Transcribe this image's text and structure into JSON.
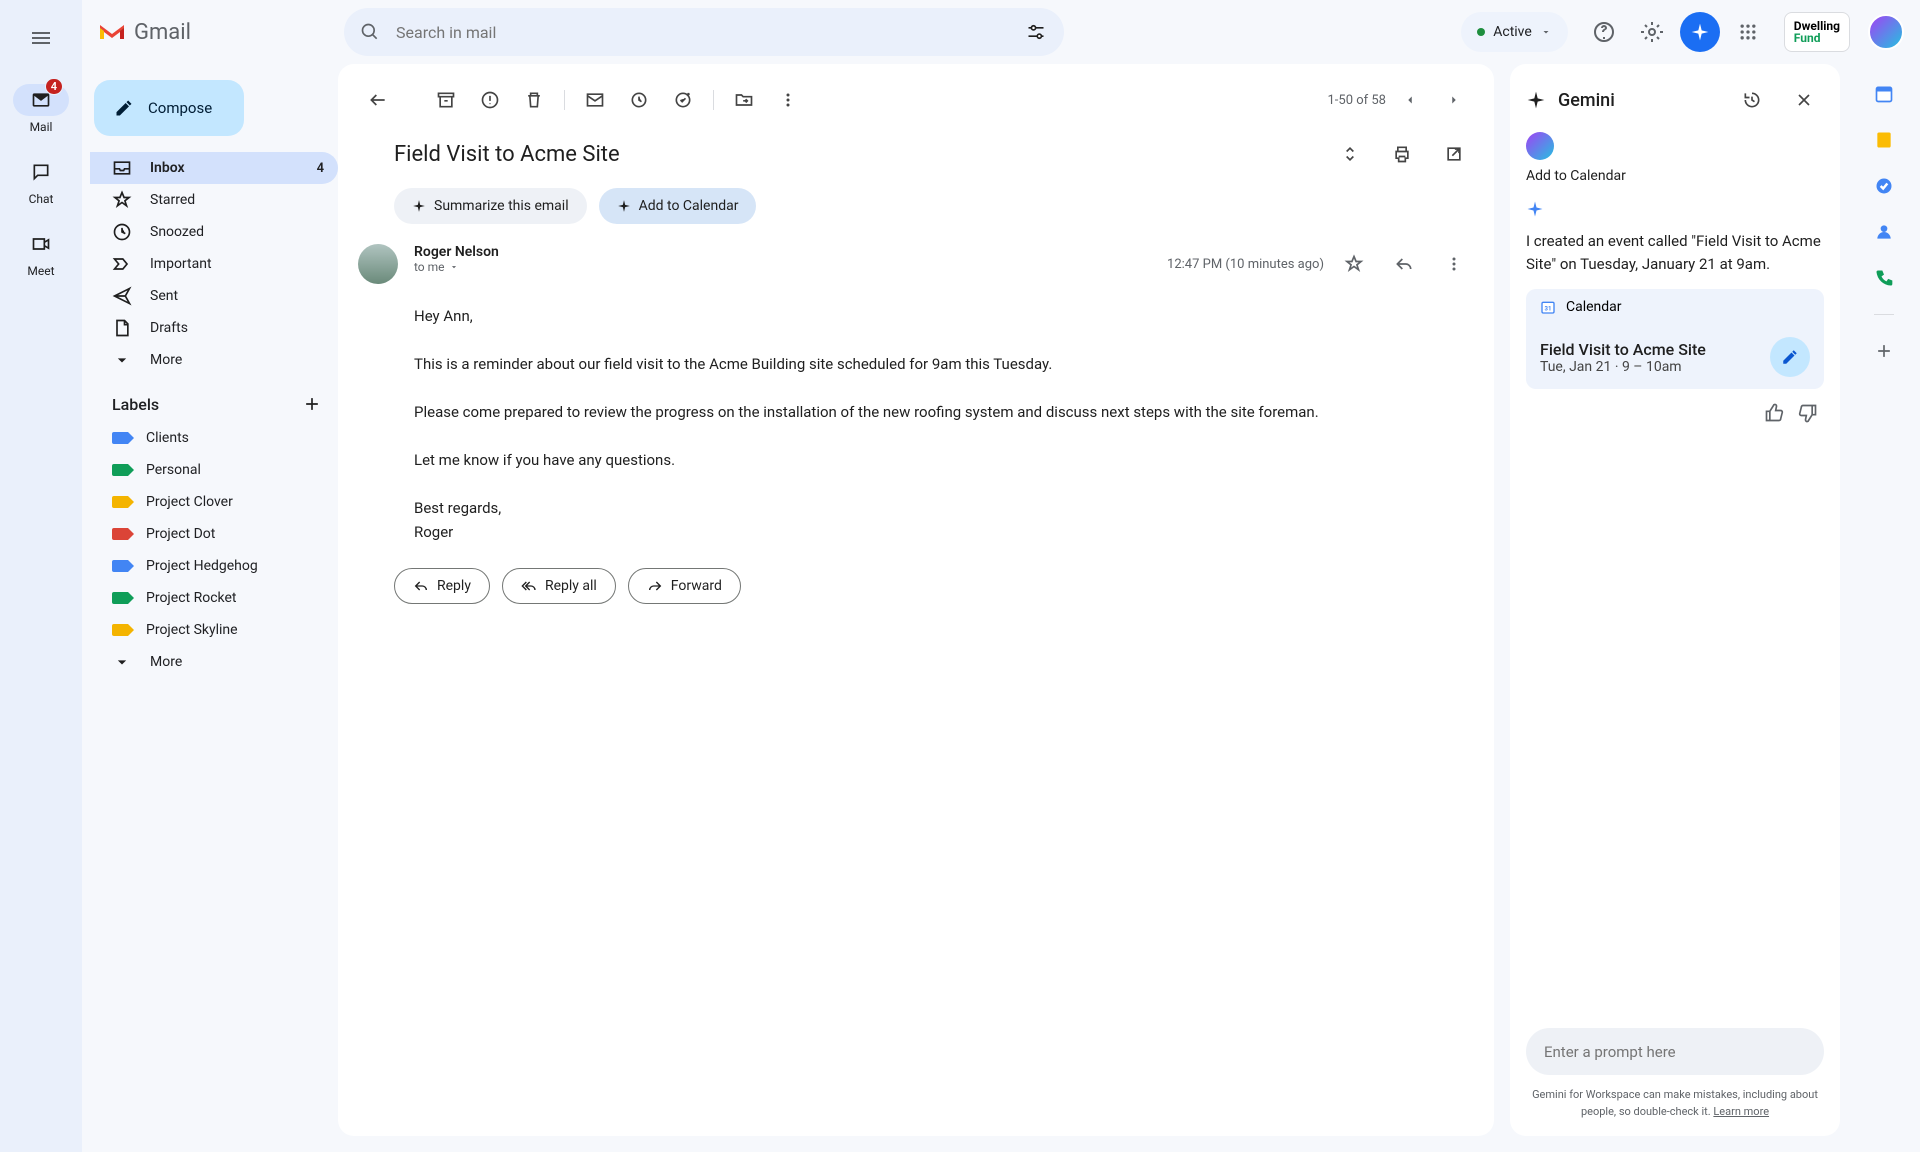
{
  "app": {
    "name": "Gmail"
  },
  "rail": {
    "mail": "Mail",
    "mail_badge": "4",
    "chat": "Chat",
    "meet": "Meet"
  },
  "search": {
    "placeholder": "Search in mail"
  },
  "status": {
    "label": "Active"
  },
  "org": {
    "line1": "Dwelling",
    "line2": "Fund"
  },
  "compose": "Compose",
  "nav": {
    "inbox": "Inbox",
    "inbox_count": "4",
    "starred": "Starred",
    "snoozed": "Snoozed",
    "important": "Important",
    "sent": "Sent",
    "drafts": "Drafts",
    "more": "More"
  },
  "labels_header": "Labels",
  "labels": [
    {
      "name": "Clients",
      "color": "#4285f4"
    },
    {
      "name": "Personal",
      "color": "#0f9d58"
    },
    {
      "name": "Project Clover",
      "color": "#f4b400"
    },
    {
      "name": "Project Dot",
      "color": "#db4437"
    },
    {
      "name": "Project Hedgehog",
      "color": "#4285f4"
    },
    {
      "name": "Project Rocket",
      "color": "#0f9d58"
    },
    {
      "name": "Project Skyline",
      "color": "#f4b400"
    }
  ],
  "labels_more": "More",
  "pager": {
    "text": "1-50 of 58"
  },
  "email": {
    "subject": "Field Visit to Acme Site",
    "chips": {
      "summarize": "Summarize this email",
      "add_calendar": "Add to Calendar"
    },
    "sender": "Roger Nelson",
    "to": "to me",
    "time": "12:47 PM (10 minutes ago)",
    "body": "Hey Ann,\n\nThis is a reminder about our field visit to the Acme Building site scheduled for 9am this Tuesday.\n\nPlease come prepared to review the progress on the installation of the new roofing system and discuss next steps with the site foreman.\n\nLet me know if you have any questions.\n\nBest regards,\nRoger",
    "actions": {
      "reply": "Reply",
      "reply_all": "Reply all",
      "forward": "Forward"
    }
  },
  "gemini": {
    "title": "Gemini",
    "context": "Add to Calendar",
    "response": "I created an event called \"Field Visit to Acme Site\" on Tuesday, January 21 at 9am.",
    "calendar_label": "Calendar",
    "event_title": "Field Visit to Acme Site",
    "event_time": "Tue, Jan 21 · 9 – 10am",
    "prompt_placeholder": "Enter a prompt here",
    "disclaimer": "Gemini for Workspace can make mistakes, including about people, so double-check it. ",
    "learn_more": "Learn more"
  }
}
